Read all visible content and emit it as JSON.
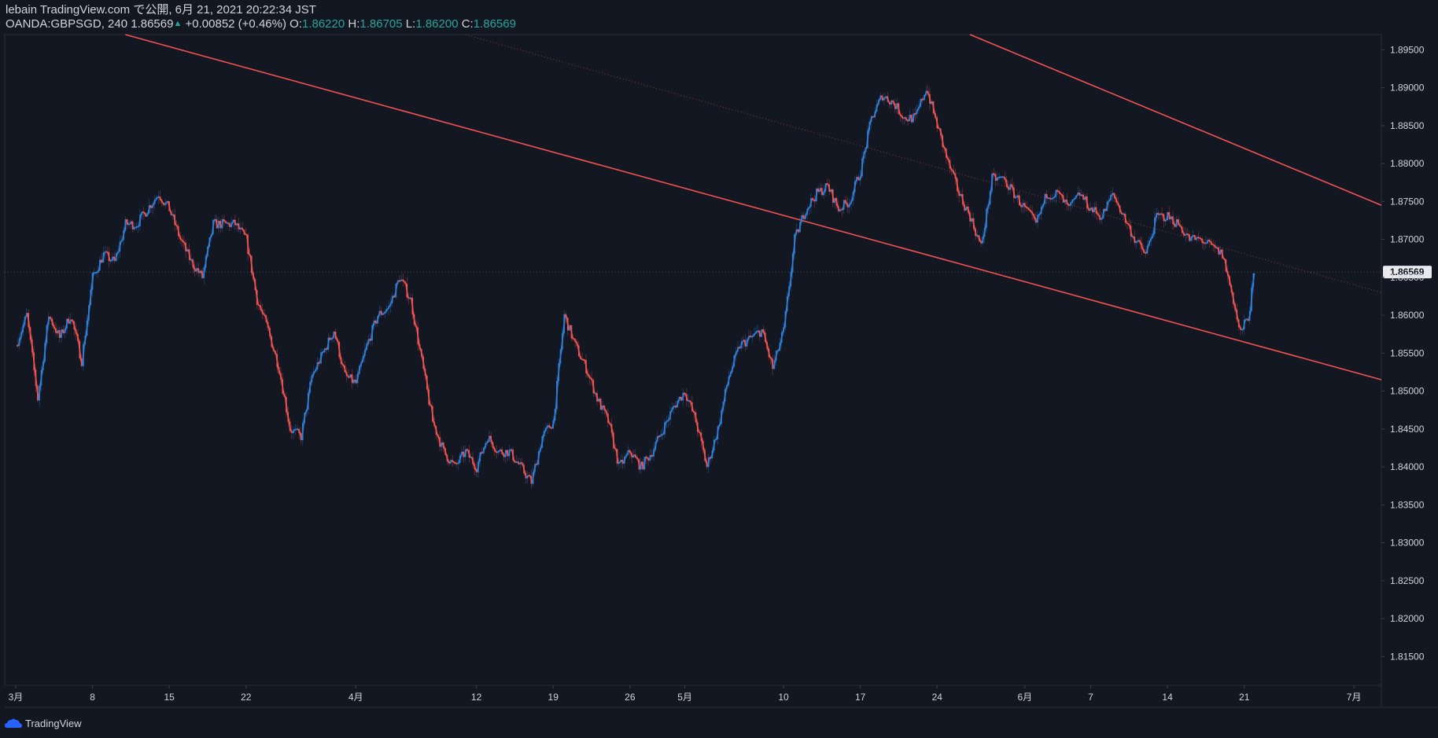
{
  "header": {
    "published": "lebain TradingView.com で公開, 6月 21, 2021 20:22:34 JST",
    "symbol": "OANDA:GBPSGD, 240",
    "last": "1.86569",
    "change": "+0.00852 (+0.46%)",
    "o_label": "O:",
    "o_value": "1.86220",
    "h_label": "H:",
    "h_value": "1.86705",
    "l_label": "L:",
    "l_value": "1.86200",
    "c_label": "C:",
    "c_value": "1.86569"
  },
  "footer": {
    "brand": "TradingView"
  },
  "colors": {
    "background": "#131722",
    "up": "#2f7fd8",
    "down": "#ef5350",
    "trendline": "#f05252",
    "text": "#d1d4dc",
    "price_tag": "#e8eaed"
  },
  "chart_data": {
    "type": "candlestick",
    "symbol": "OANDA:GBPSGD",
    "timeframe": "240",
    "ylim": [
      1.8112,
      1.897
    ],
    "y_ticks": [
      "1.89500",
      "1.89000",
      "1.88500",
      "1.88000",
      "1.87500",
      "1.87000",
      "1.86500",
      "1.86000",
      "1.85500",
      "1.85000",
      "1.84500",
      "1.84000",
      "1.83500",
      "1.83000",
      "1.82500",
      "1.82000",
      "1.81500"
    ],
    "x_ticks": [
      {
        "label": "3月",
        "day": 0
      },
      {
        "label": "8",
        "day": 7
      },
      {
        "label": "15",
        "day": 14
      },
      {
        "label": "22",
        "day": 21
      },
      {
        "label": "4月",
        "day": 31
      },
      {
        "label": "12",
        "day": 42
      },
      {
        "label": "19",
        "day": 49
      },
      {
        "label": "26",
        "day": 56
      },
      {
        "label": "5月",
        "day": 61
      },
      {
        "label": "10",
        "day": 70
      },
      {
        "label": "17",
        "day": 77
      },
      {
        "label": "24",
        "day": 84
      },
      {
        "label": "6月",
        "day": 92
      },
      {
        "label": "7",
        "day": 98
      },
      {
        "label": "14",
        "day": 105
      },
      {
        "label": "21",
        "day": 112
      },
      {
        "label": "7月",
        "day": 122
      }
    ],
    "x_range_days": [
      -1,
      124.5
    ],
    "current_price": "1.86569",
    "price_path": [
      [
        0,
        1.856
      ],
      [
        1,
        1.86
      ],
      [
        2,
        1.849
      ],
      [
        3,
        1.86
      ],
      [
        4,
        1.857
      ],
      [
        5,
        1.86
      ],
      [
        6,
        1.854
      ],
      [
        7,
        1.865
      ],
      [
        8,
        1.868
      ],
      [
        9,
        1.867
      ],
      [
        10,
        1.872
      ],
      [
        11,
        1.872
      ],
      [
        12,
        1.874
      ],
      [
        13,
        1.876
      ],
      [
        14,
        1.874
      ],
      [
        15,
        1.87
      ],
      [
        16,
        1.867
      ],
      [
        17,
        1.865
      ],
      [
        18,
        1.872
      ],
      [
        19,
        1.872
      ],
      [
        20,
        1.872
      ],
      [
        21,
        1.87
      ],
      [
        22,
        1.862
      ],
      [
        23,
        1.858
      ],
      [
        24,
        1.853
      ],
      [
        25,
        1.845
      ],
      [
        26,
        1.844
      ],
      [
        27,
        1.852
      ],
      [
        28,
        1.855
      ],
      [
        29,
        1.858
      ],
      [
        30,
        1.852
      ],
      [
        31,
        1.851
      ],
      [
        32,
        1.856
      ],
      [
        33,
        1.86
      ],
      [
        34,
        1.861
      ],
      [
        35,
        1.865
      ],
      [
        36,
        1.862
      ],
      [
        37,
        1.854
      ],
      [
        38,
        1.846
      ],
      [
        39,
        1.842
      ],
      [
        40,
        1.84
      ],
      [
        41,
        1.842
      ],
      [
        42,
        1.84
      ],
      [
        43,
        1.844
      ],
      [
        44,
        1.842
      ],
      [
        45,
        1.842
      ],
      [
        46,
        1.84
      ],
      [
        47,
        1.838
      ],
      [
        48,
        1.844
      ],
      [
        49,
        1.846
      ],
      [
        50,
        1.86
      ],
      [
        51,
        1.856
      ],
      [
        52,
        1.853
      ],
      [
        53,
        1.849
      ],
      [
        54,
        1.846
      ],
      [
        55,
        1.84
      ],
      [
        56,
        1.842
      ],
      [
        57,
        1.84
      ],
      [
        58,
        1.842
      ],
      [
        59,
        1.845
      ],
      [
        60,
        1.848
      ],
      [
        61,
        1.85
      ],
      [
        62,
        1.846
      ],
      [
        63,
        1.84
      ],
      [
        64,
        1.845
      ],
      [
        65,
        1.852
      ],
      [
        66,
        1.856
      ],
      [
        67,
        1.857
      ],
      [
        68,
        1.858
      ],
      [
        69,
        1.853
      ],
      [
        70,
        1.858
      ],
      [
        71,
        1.87
      ],
      [
        72,
        1.874
      ],
      [
        73,
        1.876
      ],
      [
        74,
        1.877
      ],
      [
        75,
        1.874
      ],
      [
        76,
        1.875
      ],
      [
        77,
        1.879
      ],
      [
        78,
        1.886
      ],
      [
        79,
        1.889
      ],
      [
        80,
        1.888
      ],
      [
        81,
        1.886
      ],
      [
        82,
        1.886
      ],
      [
        83,
        1.89
      ],
      [
        84,
        1.885
      ],
      [
        85,
        1.88
      ],
      [
        86,
        1.876
      ],
      [
        87,
        1.873
      ],
      [
        88,
        1.869
      ],
      [
        89,
        1.878
      ],
      [
        90,
        1.878
      ],
      [
        91,
        1.876
      ],
      [
        92,
        1.874
      ],
      [
        93,
        1.872
      ],
      [
        94,
        1.876
      ],
      [
        95,
        1.876
      ],
      [
        96,
        1.874
      ],
      [
        97,
        1.876
      ],
      [
        98,
        1.874
      ],
      [
        99,
        1.873
      ],
      [
        100,
        1.876
      ],
      [
        101,
        1.873
      ],
      [
        102,
        1.87
      ],
      [
        103,
        1.868
      ],
      [
        104,
        1.873
      ],
      [
        105,
        1.873
      ],
      [
        106,
        1.872
      ],
      [
        107,
        1.87
      ],
      [
        108,
        1.87
      ],
      [
        109,
        1.869
      ],
      [
        110,
        1.868
      ],
      [
        111,
        1.862
      ],
      [
        111.6,
        1.8575
      ],
      [
        112.4,
        1.86
      ],
      [
        112.9,
        1.86569
      ]
    ],
    "trendlines": [
      {
        "from": {
          "day": 10.0,
          "price": 1.897
        },
        "to": {
          "day": 124.5,
          "price": 1.8515
        },
        "style": "solid"
      },
      {
        "from": {
          "day": 87.0,
          "price": 1.897
        },
        "to": {
          "day": 124.5,
          "price": 1.8745
        },
        "style": "solid"
      },
      {
        "from": {
          "day": 41.0,
          "price": 1.897
        },
        "to": {
          "day": 124.5,
          "price": 1.863
        },
        "style": "dotted"
      }
    ]
  }
}
